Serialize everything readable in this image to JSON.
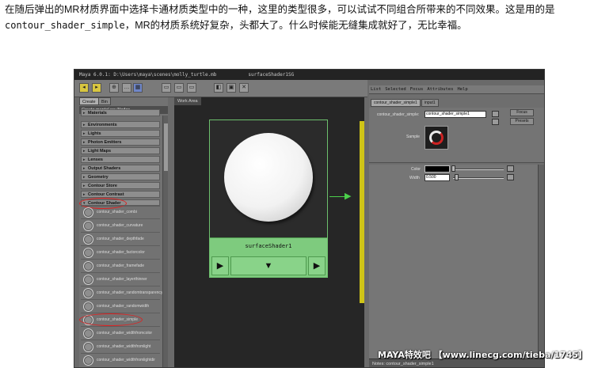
{
  "article": {
    "line1": "在随后弹出的MR材质界面中选择卡通材质类型中的一种，这里的类型很多，可以试试不同组合所带来的不同效果。这是用的是",
    "line2_code": "contour_shader_simple",
    "line2_rest": "，MR的材质系统好复杂，头都大了。什么时候能无缝集成就好了，无比幸福。"
  },
  "maya": {
    "title": "Maya 6.0.1: D:\\Users\\maya\\scenes\\molly_turtle.mb",
    "title_node": "surfaceShader1SG",
    "left_tabs": [
      "Create",
      "Bin"
    ],
    "create_header": "Create mental ray Nodes",
    "categories": [
      {
        "label": "Materials",
        "open": false
      },
      {
        "label": "Environments",
        "open": false
      },
      {
        "label": "Lights",
        "open": false
      },
      {
        "label": "Photon Emitters",
        "open": false
      },
      {
        "label": "Light Maps",
        "open": false
      },
      {
        "label": "Lenses",
        "open": false
      },
      {
        "label": "Output Shaders",
        "open": false
      },
      {
        "label": "Geometry",
        "open": false
      },
      {
        "label": "Contour Store",
        "open": false
      },
      {
        "label": "Contour Contrast",
        "open": false
      },
      {
        "label": "Contour Shader",
        "open": true
      }
    ],
    "shaders": [
      "contour_shader_combi",
      "contour_shader_curvature",
      "contour_shader_depthfade",
      "contour_shader_factorcolor",
      "contour_shader_framefade",
      "contour_shader_layerthinner",
      "contour_shader_randomtransparency",
      "contour_shader_randomwidth",
      "contour_shader_simple",
      "contour_shader_widthfromcolor",
      "contour_shader_widthfromlight",
      "contour_shader_widthfromlightdir"
    ],
    "work_area_tab": "Work Area",
    "node_name": "surfaceShader1",
    "node_buttons": [
      "▶",
      "▼",
      "▶"
    ],
    "ae_menu": [
      "List",
      "Selected",
      "Focus",
      "Attributes",
      "Help"
    ],
    "ae_tabs": [
      "contour_shader_simple1",
      "input1"
    ],
    "ae_name_label": "contour_shader_simple:",
    "ae_name_value": "contour_shader_simple1",
    "ae_focus": "Focus",
    "ae_presets": "Presets",
    "ae_sample_label": "Sample",
    "attr_color_label": "Color",
    "attr_width_label": "Width",
    "attr_width_value": "0.500",
    "notes": "Notes: contour_shader_simple1"
  },
  "watermark": "MAYA特效吧 【www.linecg.com/tieba/1745】",
  "colors": {
    "node_green": "#7ecb7e",
    "connection": "#4bd04b",
    "highlight_oval": "#dd2222",
    "yellow_strip": "#cfc417"
  }
}
